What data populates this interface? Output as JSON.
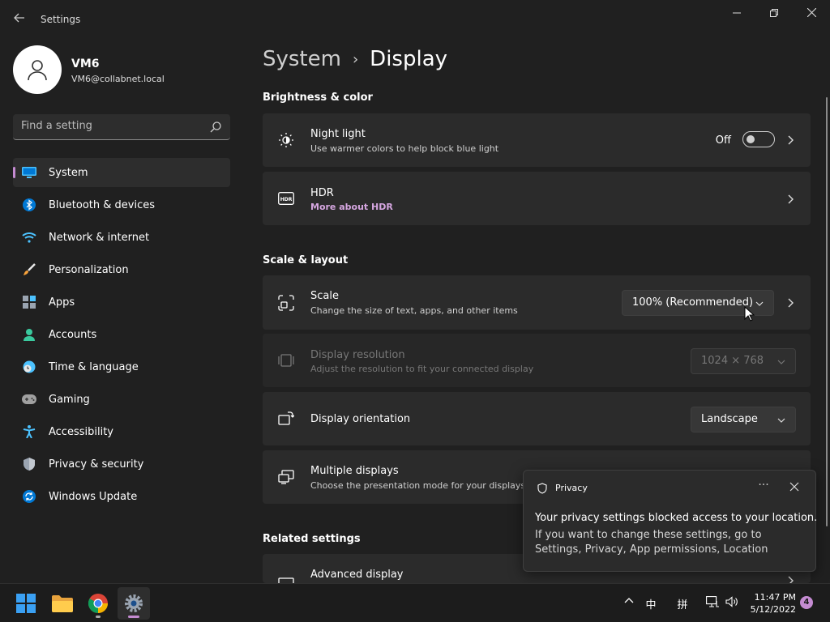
{
  "window": {
    "title": "Settings",
    "back_icon": "back-arrow-icon",
    "minimize": "—",
    "maximize": "❐",
    "close": "✕"
  },
  "profile": {
    "name": "VM6",
    "email": "VM6@collabnet.local"
  },
  "search": {
    "placeholder": "Find a setting"
  },
  "sidebar": {
    "items": [
      {
        "label": "System",
        "icon": "monitor-icon",
        "active": true
      },
      {
        "label": "Bluetooth & devices",
        "icon": "bluetooth-icon"
      },
      {
        "label": "Network & internet",
        "icon": "wifi-icon"
      },
      {
        "label": "Personalization",
        "icon": "brush-icon"
      },
      {
        "label": "Apps",
        "icon": "apps-icon"
      },
      {
        "label": "Accounts",
        "icon": "person-icon"
      },
      {
        "label": "Time & language",
        "icon": "clock-globe-icon"
      },
      {
        "label": "Gaming",
        "icon": "gamepad-icon"
      },
      {
        "label": "Accessibility",
        "icon": "accessibility-icon"
      },
      {
        "label": "Privacy & security",
        "icon": "shield-icon"
      },
      {
        "label": "Windows Update",
        "icon": "update-icon"
      }
    ]
  },
  "breadcrumb": {
    "parent": "System",
    "separator": "›",
    "current": "Display"
  },
  "sections": {
    "brightness": "Brightness & color",
    "scale": "Scale & layout",
    "related": "Related settings"
  },
  "night_light": {
    "title": "Night light",
    "subtitle": "Use warmer colors to help block blue light",
    "state": "Off"
  },
  "hdr": {
    "title": "HDR",
    "link": "More about HDR"
  },
  "scale_card": {
    "title": "Scale",
    "subtitle": "Change the size of text, apps, and other items",
    "value": "100% (Recommended)"
  },
  "resolution": {
    "title": "Display resolution",
    "subtitle": "Adjust the resolution to fit your connected display",
    "value": "1024 × 768"
  },
  "orientation": {
    "title": "Display orientation",
    "value": "Landscape"
  },
  "multiple": {
    "title": "Multiple displays",
    "subtitle": "Choose the presentation mode for your displays"
  },
  "advanced": {
    "title": "Advanced display"
  },
  "toast": {
    "app": "Privacy",
    "more": "···",
    "title": "Your privacy settings blocked access to your location.",
    "body": "If you want to change these settings, go to Settings, Privacy, App permissions, Location"
  },
  "taskbar": {
    "apps": [
      "start-icon",
      "file-explorer-icon",
      "chrome-icon",
      "settings-icon"
    ],
    "tray": {
      "chevron": "^",
      "ime_lang": "中",
      "ime_mode": "拼"
    },
    "time": "11:47 PM",
    "date": "5/12/2022",
    "notification_count": "4"
  },
  "colors": {
    "background": "#202020",
    "card": "#2b2b2b",
    "accent": "#c48bd1"
  }
}
